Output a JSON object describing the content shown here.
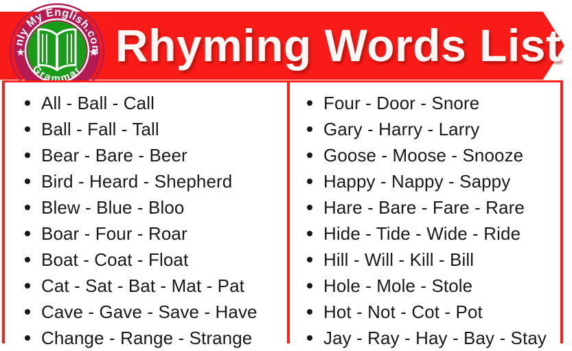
{
  "header": {
    "title": "Rhyming Words List",
    "banner_color": "#f91b17",
    "title_color": "#fdf7f5",
    "logo": {
      "top_text": "Only My English.com",
      "bottom_text": "Grammar",
      "icon": "open-book-icon",
      "ring_color": "#b31b52",
      "center_color": "#1a9b1a",
      "star_glyph": "★"
    }
  },
  "frame": {
    "border_color": "#fa2019",
    "divider_color": "#fa2019"
  },
  "columns": {
    "left": [
      "All - Ball - Call",
      "Ball - Fall - Tall",
      "Bear - Bare - Beer",
      "Bird - Heard - Shepherd",
      "Blew - Blue - Bloo",
      "Boar - Four - Roar",
      "Boat - Coat - Float",
      "Cat - Sat - Bat - Mat - Pat",
      "Cave - Gave - Save - Have",
      "Change - Range - Strange"
    ],
    "right": [
      "Four - Door - Snore",
      "Gary - Harry - Larry",
      "Goose - Moose - Snooze",
      "Happy - Nappy - Sappy",
      "Hare - Bare - Fare - Rare",
      "Hide - Tide - Wide - Ride",
      "Hill - Will - Kill - Bill",
      "Hole - Mole - Stole",
      "Hot - Not - Cot - Pot",
      "Jay - Ray - Hay - Bay - Stay"
    ]
  }
}
